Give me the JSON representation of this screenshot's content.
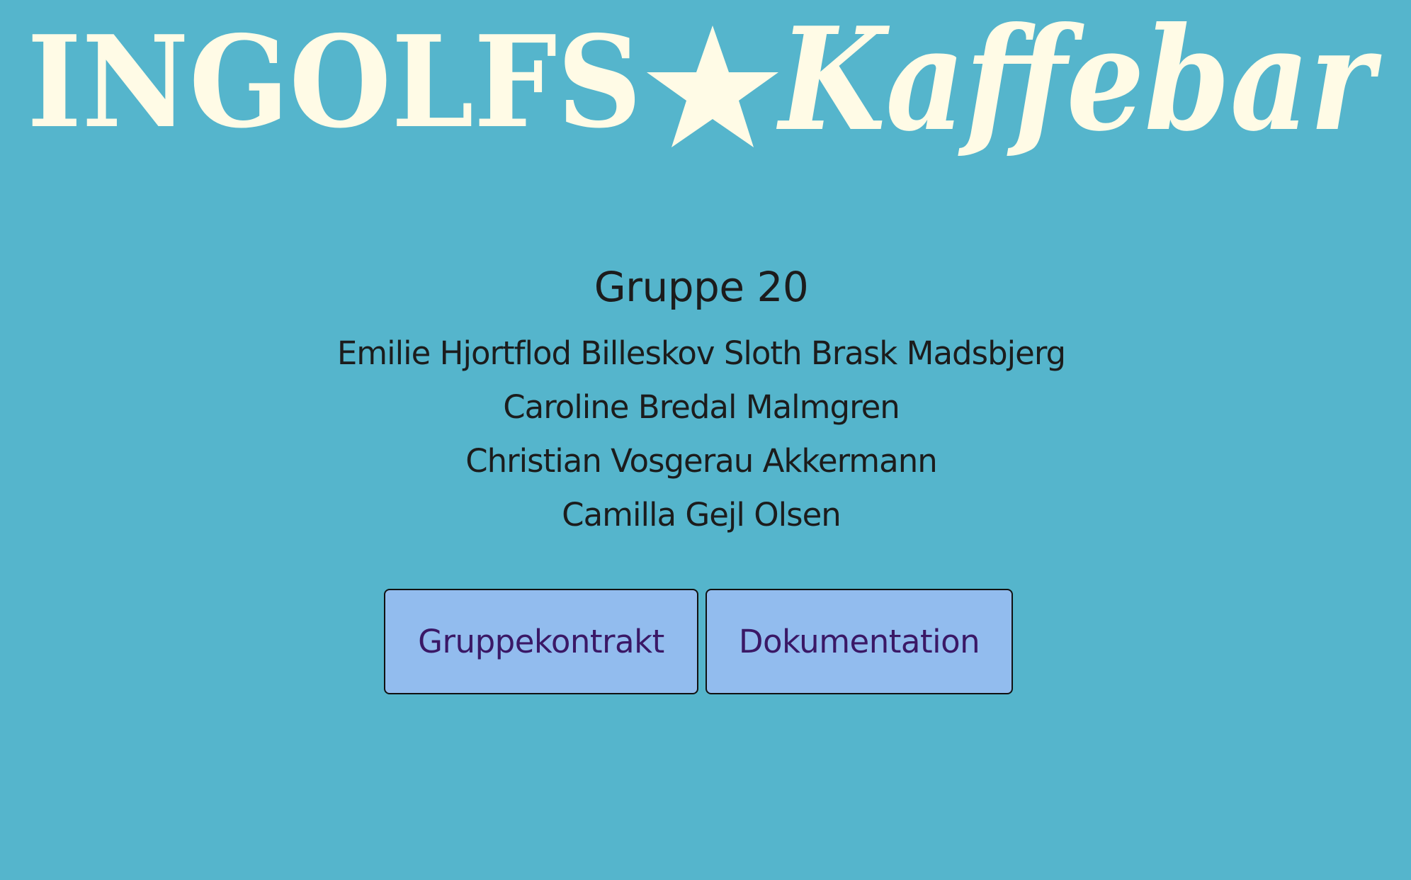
{
  "logo": {
    "text_left": "INGOLFS",
    "text_right": "Kaffebar",
    "color": "#fffbe6"
  },
  "page": {
    "title": "Gruppe 20",
    "background": "#55b5cc"
  },
  "members": [
    "Emilie Hjortflod Billeskov Sloth Brask Madsbjerg",
    "Caroline Bredal Malmgren",
    "Christian Vosgerau Akkermann",
    "Camilla Gejl Olsen"
  ],
  "buttons": {
    "contract_label": "Gruppekontrakt",
    "docs_label": "Dokumentation",
    "fill_color": "#92bcee",
    "text_color": "#3a1866"
  }
}
